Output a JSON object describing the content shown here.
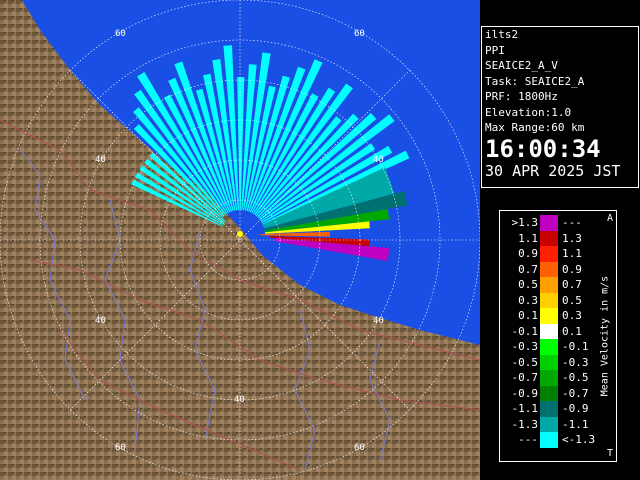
{
  "info": {
    "radar": "ilts2",
    "mode": "PPI",
    "product": "SEAICE2_A_V",
    "task": "Task: SEAICE2_A",
    "prf": "PRF: 1800Hz",
    "elevation": "Elevation:1.0",
    "max_range": "Max Range:60 km",
    "time": "16:00:34",
    "date": "30 APR 2025 JST"
  },
  "map": {
    "range_ring_labels": [
      "60",
      "60",
      "40",
      "40",
      "40",
      "40",
      "60",
      "60"
    ],
    "colors": {
      "sea": "#1a4fe6",
      "land": "#8a7050",
      "grid": "#ffffff",
      "rivers": "#7a7ad8",
      "roads": "#b05050"
    }
  },
  "legend": {
    "title": "Mean Velocity in m/s",
    "corner_top": "A",
    "corner_bottom": "T",
    "rows": [
      {
        "lo": ">1.3",
        "hi": "---",
        "color": "#c000c0"
      },
      {
        "lo": "1.1",
        "hi": "1.3",
        "color": "#c80000"
      },
      {
        "lo": "0.9",
        "hi": "1.1",
        "color": "#ff2000"
      },
      {
        "lo": "0.7",
        "hi": "0.9",
        "color": "#ff6000"
      },
      {
        "lo": "0.5",
        "hi": "0.7",
        "color": "#ffa000"
      },
      {
        "lo": "0.3",
        "hi": "0.5",
        "color": "#ffd000"
      },
      {
        "lo": "0.1",
        "hi": "0.3",
        "color": "#ffff00"
      },
      {
        "lo": "-0.1",
        "hi": "0.1",
        "color": "#ffffff"
      },
      {
        "lo": "-0.3",
        "hi": "-0.1",
        "color": "#00ff00"
      },
      {
        "lo": "-0.5",
        "hi": "-0.3",
        "color": "#00d000"
      },
      {
        "lo": "-0.7",
        "hi": "-0.5",
        "color": "#00a800"
      },
      {
        "lo": "-0.9",
        "hi": "-0.7",
        "color": "#008000"
      },
      {
        "lo": "-1.1",
        "hi": "-0.9",
        "color": "#007070"
      },
      {
        "lo": "-1.3",
        "hi": "-1.1",
        "color": "#00a8a8"
      },
      {
        "lo": "---",
        "hi": "<-1.3",
        "color": "#00ffff"
      }
    ]
  }
}
